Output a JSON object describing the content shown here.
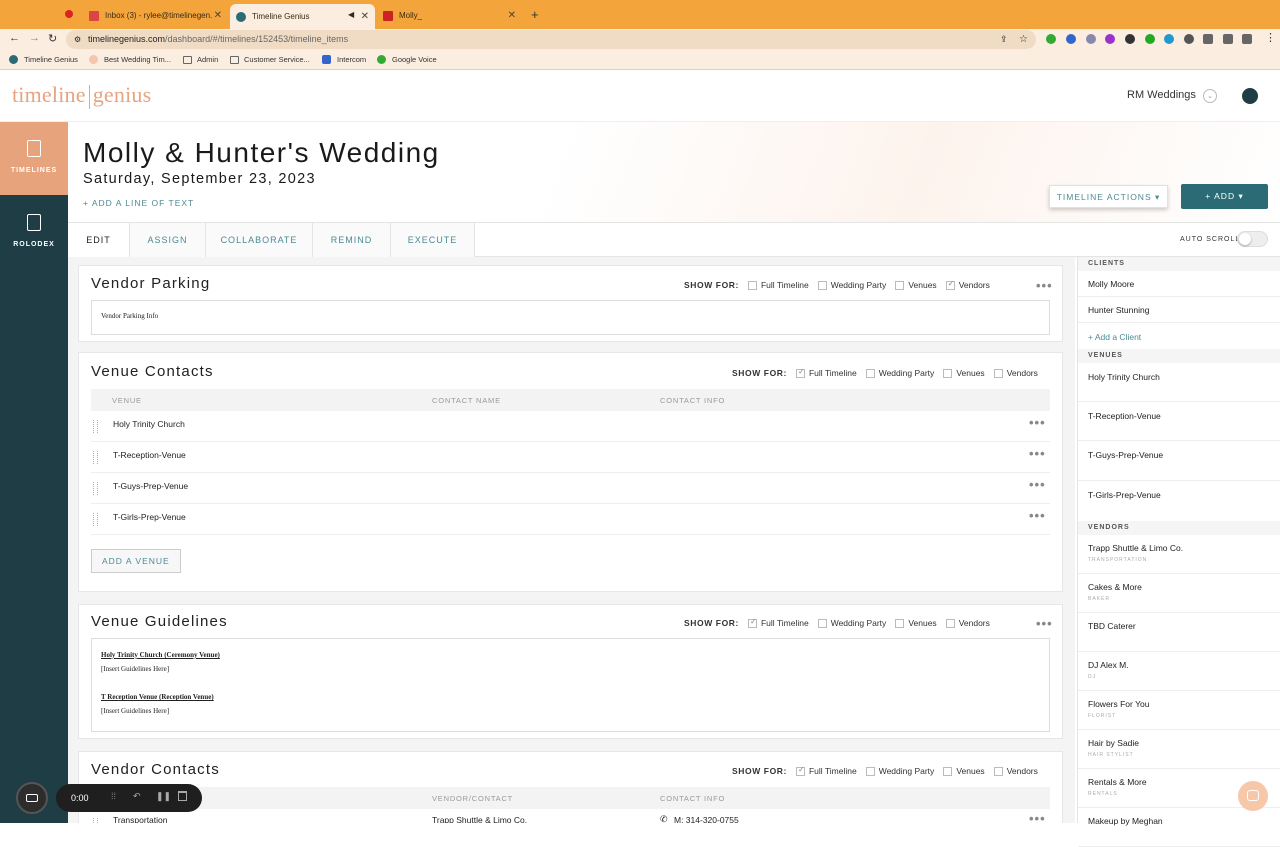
{
  "browser": {
    "tabs": [
      {
        "label": "Inbox (3) - rylee@timelinegen..."
      },
      {
        "label": "Timeline Genius"
      },
      {
        "label": "Molly_"
      }
    ],
    "url_host": "timelinegenius.com",
    "url_path": "/dashboard/#/timelines/152453/timeline_items",
    "bookmarks": [
      "Timeline Genius",
      "Best Wedding Tim...",
      "Admin",
      "Customer Service...",
      "Intercom",
      "Google Voice"
    ]
  },
  "app": {
    "logo_left": "timeline",
    "logo_right": "genius",
    "company": "RM Weddings",
    "nav": {
      "timelines": "TIMELINES",
      "rolodex": "ROLODEX"
    }
  },
  "hero": {
    "title": "Molly & Hunter's Wedding",
    "date": "Saturday, September 23, 2023",
    "add_line": "+ ADD A LINE OF TEXT",
    "timeline_actions": "TIMELINE ACTIONS ▾",
    "add_button": "+ ADD  ▾"
  },
  "tabs": [
    "EDIT",
    "ASSIGN",
    "COLLABORATE",
    "REMIND",
    "EXECUTE"
  ],
  "auto_scroll": "AUTO SCROLL",
  "show_for_label": "SHOW FOR:",
  "show_options": [
    "Full Timeline",
    "Wedding Party",
    "Venues",
    "Vendors"
  ],
  "sections": {
    "vendor_parking": {
      "title": "Vendor Parking",
      "checked": [
        false,
        false,
        false,
        true
      ],
      "content": "Vendor Parking Info"
    },
    "venue_contacts": {
      "title": "Venue Contacts",
      "checked": [
        true,
        false,
        false,
        false
      ],
      "columns": [
        "VENUE",
        "CONTACT NAME",
        "CONTACT INFO"
      ],
      "rows": [
        "Holy Trinity Church",
        "T-Reception-Venue",
        "T-Guys-Prep-Venue",
        "T-Girls-Prep-Venue"
      ],
      "add_button": "ADD A VENUE"
    },
    "venue_guidelines": {
      "title": "Venue Guidelines",
      "checked": [
        true,
        false,
        false,
        false
      ],
      "heading1": "Holy Trinity Church (Ceremony Venue)",
      "body1": "[Insert Guidelines Here]",
      "heading2": "T Reception Venue (Reception Venue)",
      "body2": "[Insert Guidelines Here]"
    },
    "vendor_contacts": {
      "title": "Vendor Contacts",
      "checked": [
        true,
        false,
        false,
        false
      ],
      "columns": [
        "VENDOR/CONTACT",
        "CONTACT INFO"
      ],
      "row_type": "Transportation",
      "row_vendor": "Trapp Shuttle & Limo Co.",
      "row_phone": "M: 314-320-0755"
    }
  },
  "right_panel": {
    "clients_header": "CLIENTS",
    "clients": [
      "Molly Moore",
      "Hunter Stunning"
    ],
    "add_client": "+ Add a Client",
    "venues_header": "VENUES",
    "venues": [
      "Holy Trinity Church",
      "T-Reception-Venue",
      "T-Guys-Prep-Venue",
      "T-Girls-Prep-Venue"
    ],
    "vendors_header": "VENDORS",
    "vendors": [
      {
        "name": "Trapp Shuttle & Limo Co.",
        "type": "TRANSPORTATION"
      },
      {
        "name": "Cakes & More",
        "type": "BAKER"
      },
      {
        "name": "TBD Caterer",
        "type": ""
      },
      {
        "name": "DJ Alex M.",
        "type": "DJ"
      },
      {
        "name": "Flowers For You",
        "type": "FLORIST"
      },
      {
        "name": "Hair by Sadie",
        "type": "HAIR STYLIST"
      },
      {
        "name": "Rentals & More",
        "type": "RENTALS"
      },
      {
        "name": "Makeup by Meghan",
        "type": ""
      }
    ]
  },
  "recorder": {
    "time": "0:00"
  },
  "colors": {
    "accent": "#e7a37b",
    "teal": "#2a6b75",
    "sidebar": "#1f3d45",
    "chrome": "#f3a53c"
  }
}
